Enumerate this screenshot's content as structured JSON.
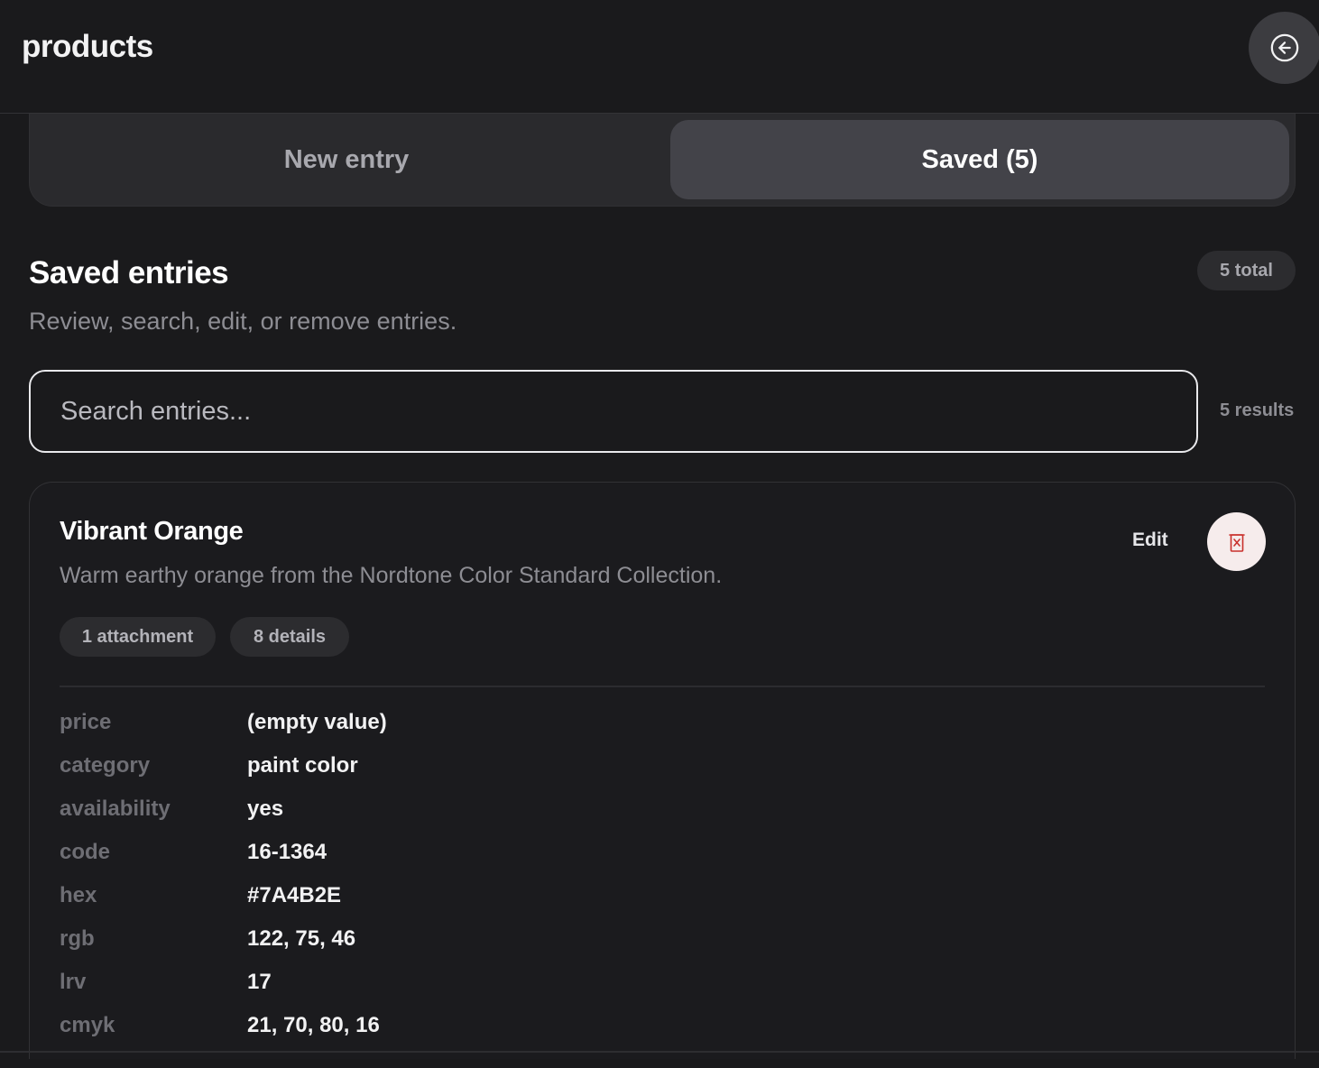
{
  "header": {
    "title": "products",
    "back_icon": "arrow-left-circle-icon"
  },
  "tabs": [
    {
      "label": "New entry",
      "active": false
    },
    {
      "label": "Saved (5)",
      "active": true
    }
  ],
  "section": {
    "title": "Saved entries",
    "subtitle": "Review, search, edit, or remove entries.",
    "total_badge": "5 total"
  },
  "search": {
    "placeholder": "Search entries...",
    "value": "",
    "results_label": "5 results"
  },
  "entries": [
    {
      "title": "Vibrant Orange",
      "description": "Warm earthy orange from the Nordtone Color Standard Collection.",
      "edit_label": "Edit",
      "delete_icon": "trash-icon",
      "pills": [
        "1 attachment",
        "8 details"
      ],
      "details": [
        {
          "key": "price",
          "value": "(empty value)"
        },
        {
          "key": "category",
          "value": "paint color"
        },
        {
          "key": "availability",
          "value": "yes"
        },
        {
          "key": "code",
          "value": "16-1364"
        },
        {
          "key": "hex",
          "value": "#7A4B2E"
        },
        {
          "key": "rgb",
          "value": "122, 75, 46"
        },
        {
          "key": "lrv",
          "value": "17"
        },
        {
          "key": "cmyk",
          "value": "21, 70, 80, 16"
        }
      ]
    }
  ],
  "colors": {
    "background": "#1a1a1c",
    "tab_active": "#434349",
    "delete_accent": "#c9302c",
    "delete_bg": "#f6ecec"
  }
}
